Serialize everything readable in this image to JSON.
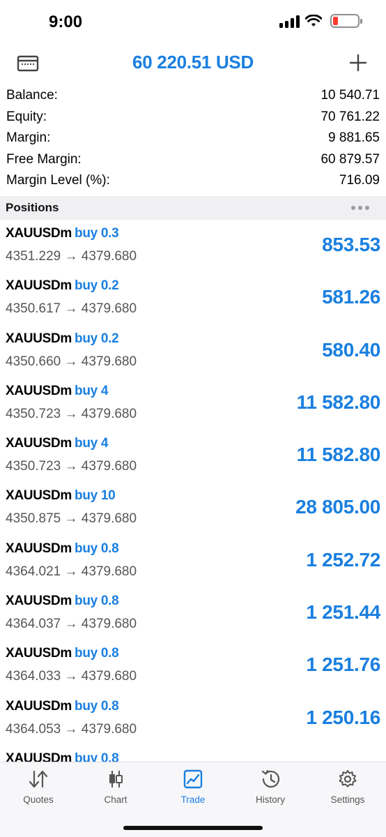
{
  "status_bar": {
    "time": "9:00",
    "battery_level": 0.2,
    "battery_color": "#ff3b30"
  },
  "header": {
    "title": "60 220.51 USD",
    "left_icon": "card-icon",
    "right_icon": "plus-icon"
  },
  "summary": [
    {
      "label": "Balance:",
      "value": "10 540.71"
    },
    {
      "label": "Equity:",
      "value": "70 761.22"
    },
    {
      "label": "Margin:",
      "value": "9 881.65"
    },
    {
      "label": "Free Margin:",
      "value": "60 879.57"
    },
    {
      "label": "Margin Level (%):",
      "value": "716.09"
    }
  ],
  "positions": {
    "title": "Positions",
    "items": [
      {
        "symbol": "XAUUSDm",
        "side": "buy 0.3",
        "prices": "4351.229 → 4379.680",
        "profit": "853.53"
      },
      {
        "symbol": "XAUUSDm",
        "side": "buy 0.2",
        "prices": "4350.617 → 4379.680",
        "profit": "581.26"
      },
      {
        "symbol": "XAUUSDm",
        "side": "buy 0.2",
        "prices": "4350.660 → 4379.680",
        "profit": "580.40"
      },
      {
        "symbol": "XAUUSDm",
        "side": "buy 4",
        "prices": "4350.723 → 4379.680",
        "profit": "11 582.80"
      },
      {
        "symbol": "XAUUSDm",
        "side": "buy 4",
        "prices": "4350.723 → 4379.680",
        "profit": "11 582.80"
      },
      {
        "symbol": "XAUUSDm",
        "side": "buy 10",
        "prices": "4350.875 → 4379.680",
        "profit": "28 805.00"
      },
      {
        "symbol": "XAUUSDm",
        "side": "buy 0.8",
        "prices": "4364.021 → 4379.680",
        "profit": "1 252.72"
      },
      {
        "symbol": "XAUUSDm",
        "side": "buy 0.8",
        "prices": "4364.037 → 4379.680",
        "profit": "1 251.44"
      },
      {
        "symbol": "XAUUSDm",
        "side": "buy 0.8",
        "prices": "4364.033 → 4379.680",
        "profit": "1 251.76"
      },
      {
        "symbol": "XAUUSDm",
        "side": "buy 0.8",
        "prices": "4364.053 → 4379.680",
        "profit": "1 250.16"
      },
      {
        "symbol": "XAUUSDm",
        "side": "buy 0.8",
        "prices": "",
        "profit": ""
      }
    ]
  },
  "tabs": [
    {
      "label": "Quotes",
      "icon": "quotes-icon",
      "active": false
    },
    {
      "label": "Chart",
      "icon": "chart-icon",
      "active": false
    },
    {
      "label": "Trade",
      "icon": "trade-icon",
      "active": true
    },
    {
      "label": "History",
      "icon": "history-icon",
      "active": false
    },
    {
      "label": "Settings",
      "icon": "settings-icon",
      "active": false
    }
  ],
  "colors": {
    "accent": "#1a7fe0",
    "tab_inactive": "#555555",
    "section_bg": "#f0f0f3"
  }
}
